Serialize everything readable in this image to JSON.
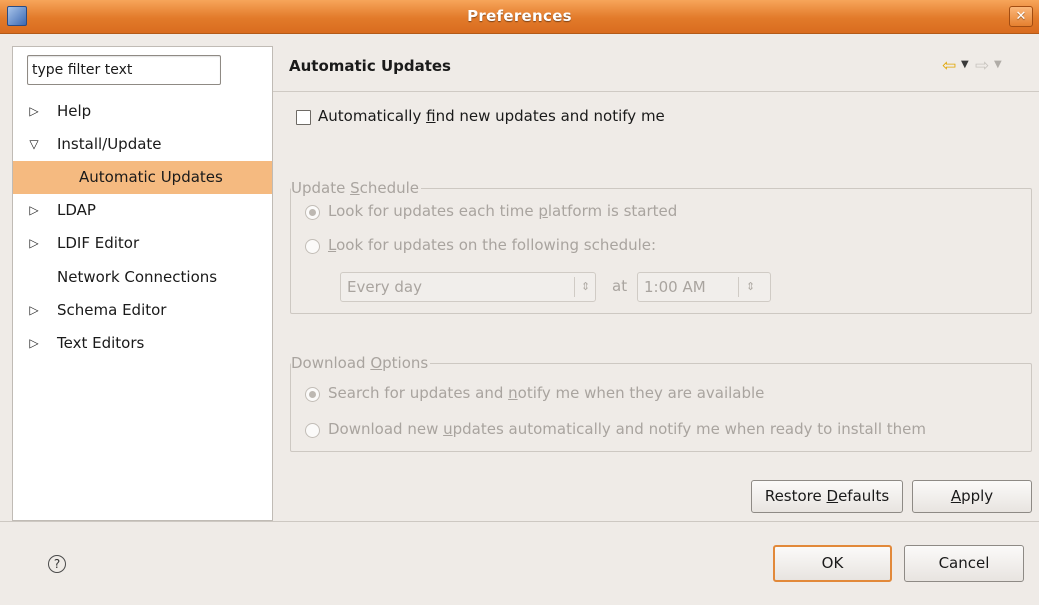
{
  "window": {
    "title": "Preferences",
    "close_glyph": "✕"
  },
  "filter": {
    "value": "type filter text"
  },
  "tree": [
    {
      "label": "Help",
      "arrow": "▷",
      "expanded": false
    },
    {
      "label": "Install/Update",
      "arrow": "▽",
      "expanded": true
    },
    {
      "label": "Automatic Updates",
      "arrow": "",
      "selected": true
    },
    {
      "label": "LDAP",
      "arrow": "▷"
    },
    {
      "label": "LDIF Editor",
      "arrow": "▷"
    },
    {
      "label": "Network Connections",
      "arrow": ""
    },
    {
      "label": "Schema Editor",
      "arrow": "▷"
    },
    {
      "label": "Text Editors",
      "arrow": "▷"
    }
  ],
  "page": {
    "title": "Automatic Updates",
    "nav_back_icon": "back-arrow-icon",
    "nav_forward_icon": "forward-arrow-icon"
  },
  "auto_find": {
    "checked": false,
    "label_pre": "Automatically ",
    "label_mnemonic": "f",
    "label_post": "ind new updates and notify me"
  },
  "schedule": {
    "legend_pre": "Update ",
    "legend_mnemonic": "S",
    "legend_post": "chedule",
    "option1_pre": "Look for updates each time ",
    "option1_mnemonic": "p",
    "option1_post": "latform is started",
    "option1_selected": true,
    "option2_mnemonic": "L",
    "option2_post": "ook for updates on the following schedule:",
    "option2_selected": false,
    "day_value": "Every day",
    "at_label": "at",
    "time_value": "1:00 AM"
  },
  "download": {
    "legend_pre": "Download ",
    "legend_mnemonic": "O",
    "legend_post": "ptions",
    "option1_pre": "Search for updates and ",
    "option1_mnemonic": "n",
    "option1_post": "otify me when they are available",
    "option1_selected": true,
    "option2_pre": "Download new ",
    "option2_mnemonic": "u",
    "option2_post": "pdates automatically and notify me when ready to install them",
    "option2_selected": false
  },
  "buttons": {
    "restore_pre": "Restore ",
    "restore_mnemonic": "D",
    "restore_post": "efaults",
    "apply_mnemonic": "A",
    "apply_post": "pply",
    "ok": "OK",
    "cancel": "Cancel",
    "help_glyph": "?"
  },
  "colors": {
    "title_bar": "#e27a2a",
    "selection": "#f5ba80",
    "default_button_border": "#e2893a",
    "nav_back_arrow": "#e0a500"
  }
}
